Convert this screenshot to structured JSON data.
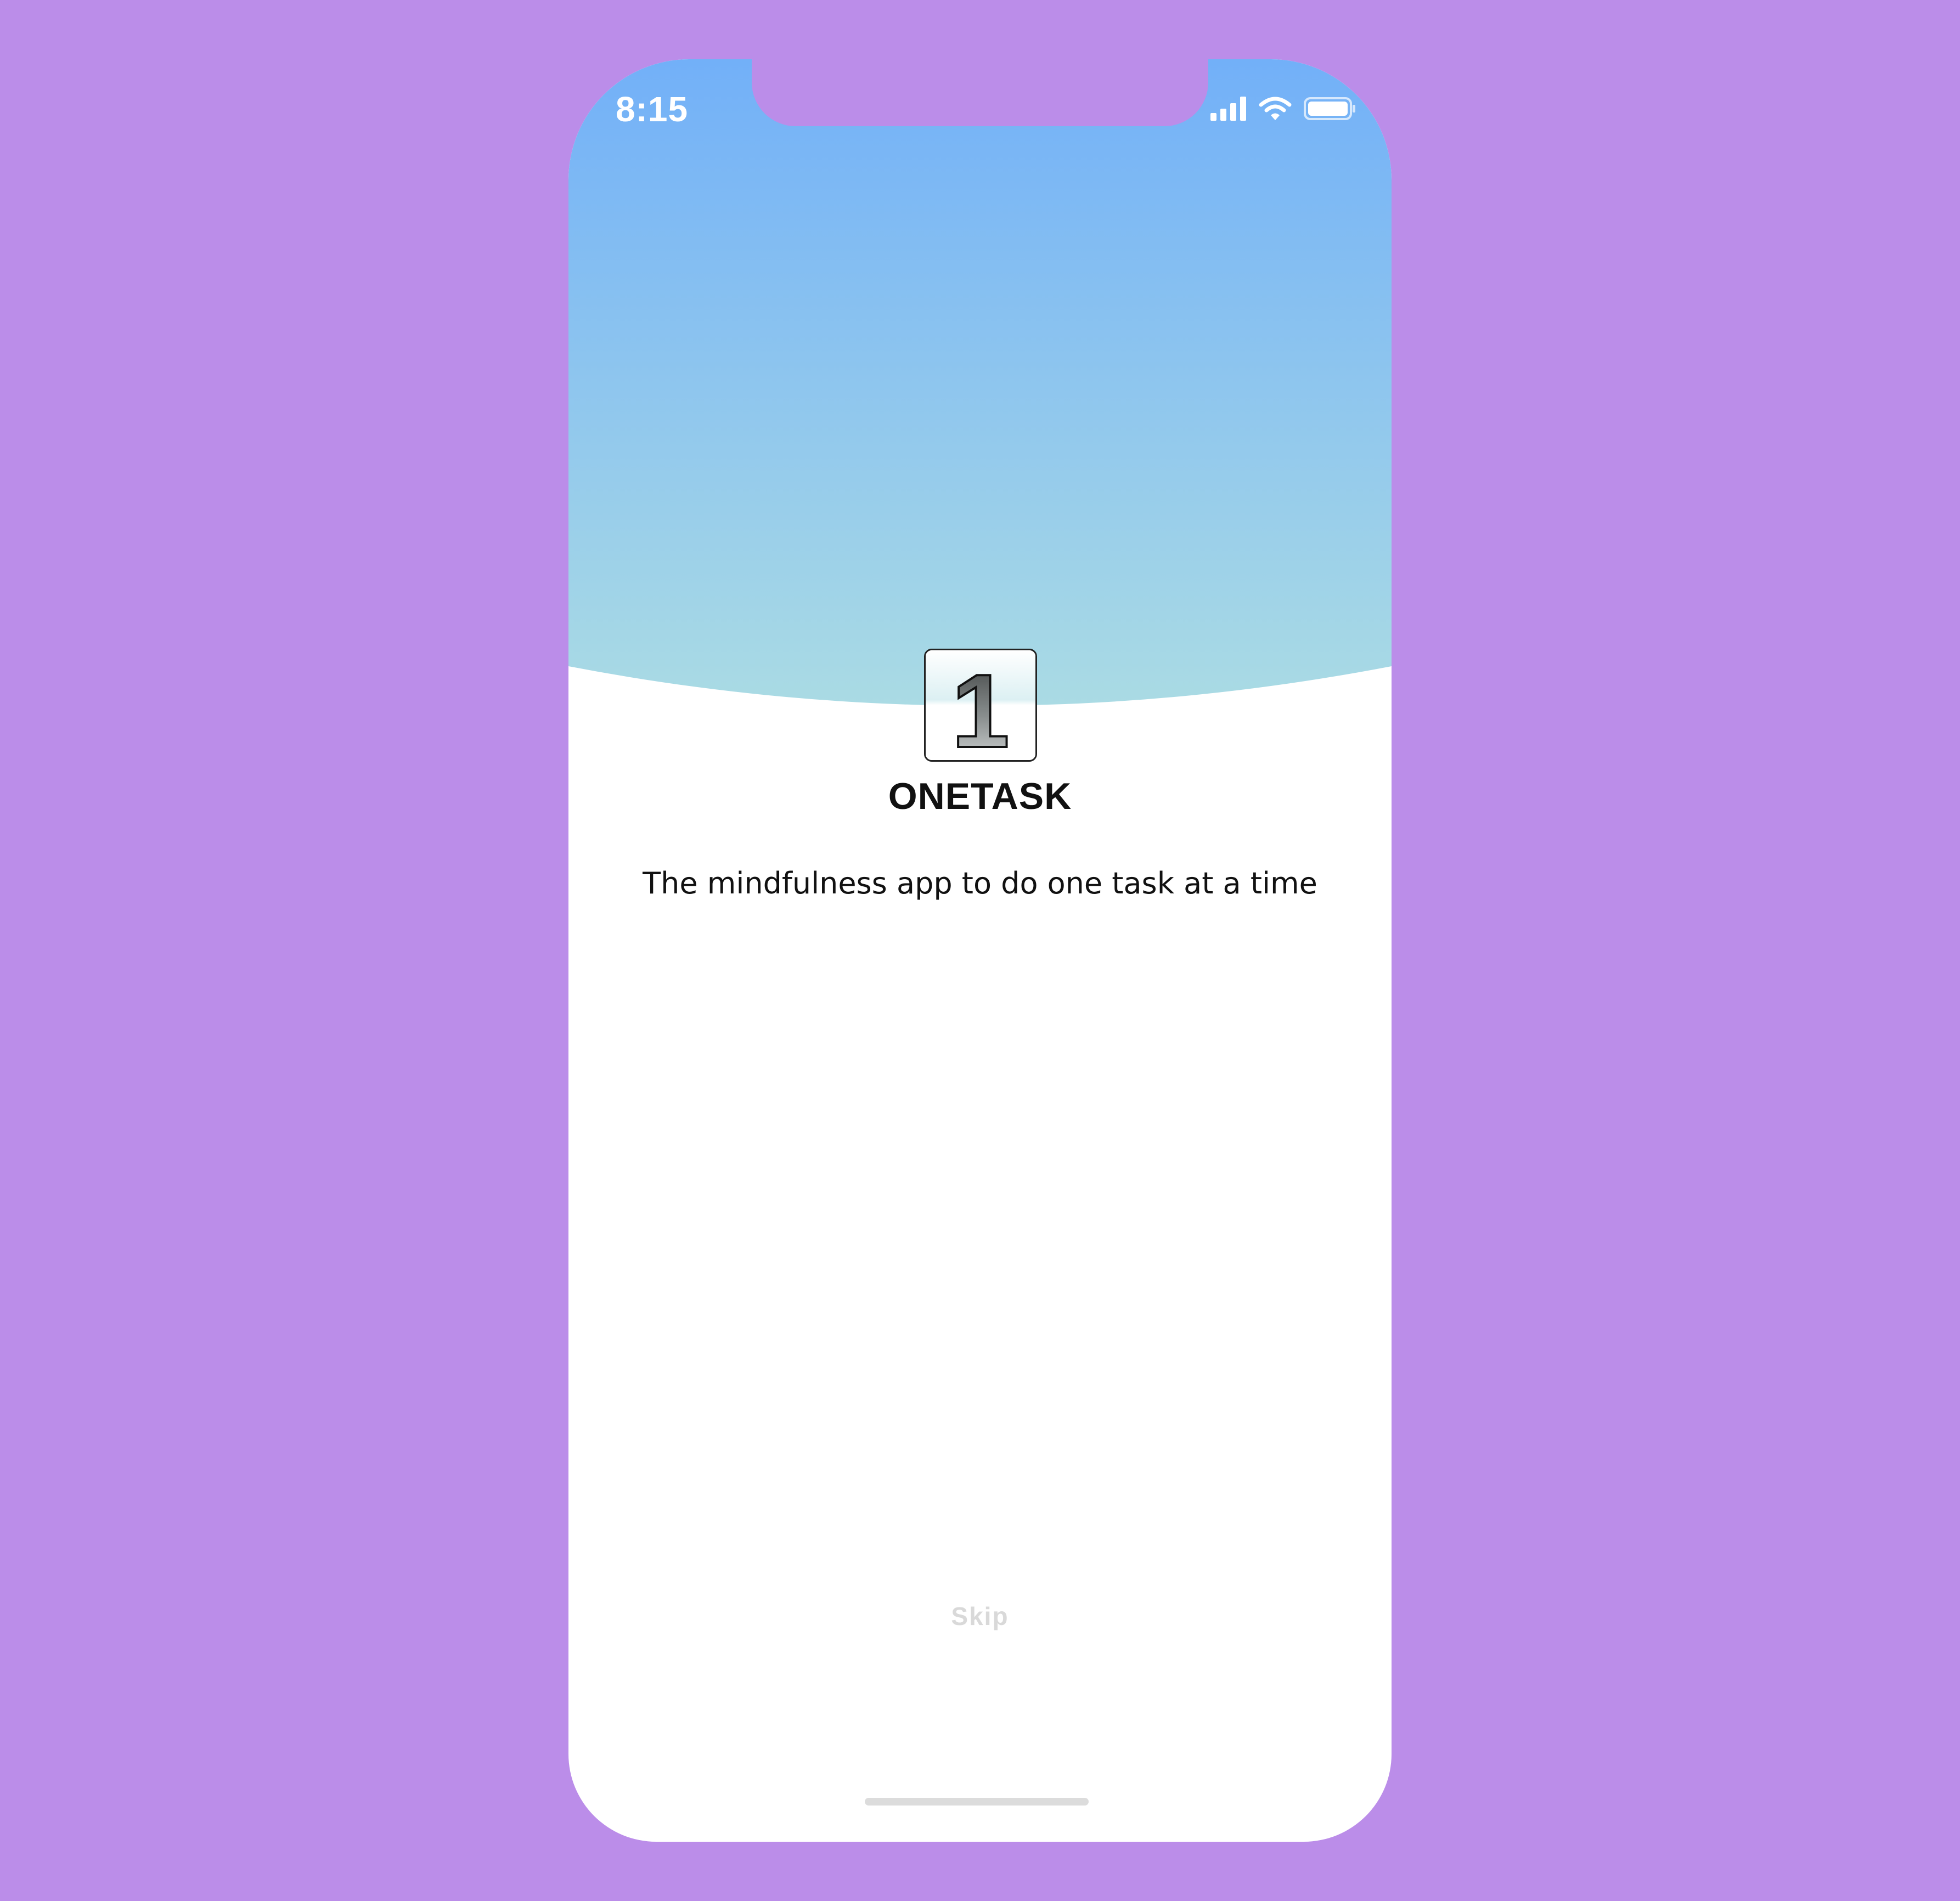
{
  "status_bar": {
    "time": "8:15",
    "icons": [
      "signal-icon",
      "wifi-icon",
      "battery-icon"
    ]
  },
  "app": {
    "logo_glyph": "1",
    "name": "ONETASK",
    "tagline": "The mindfulness app to do one task at a time"
  },
  "actions": {
    "skip_label": "Skip"
  },
  "colors": {
    "background": "#bb8de9",
    "gradient_top": "#72b0f8",
    "gradient_bottom": "#aadbe4",
    "surface": "#ffffff",
    "skip_text": "#d9d9d9"
  }
}
